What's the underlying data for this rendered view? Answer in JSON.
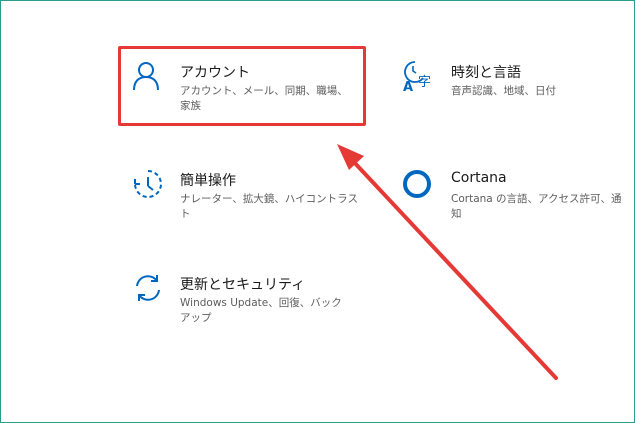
{
  "settings": {
    "tiles": [
      {
        "title": "アカウント",
        "desc": "アカウント、メール、同期、職場、家族",
        "icon": "person-icon"
      },
      {
        "title": "時刻と言語",
        "desc": "音声認識、地域、日付",
        "icon": "time-language-icon"
      },
      {
        "title": "簡単操作",
        "desc": "ナレーター、拡大鏡、ハイコントラスト",
        "icon": "ease-of-access-icon"
      },
      {
        "title": "Cortana",
        "desc": "Cortana の言語、アクセス許可、通知",
        "icon": "cortana-icon"
      },
      {
        "title": "更新とセキュリティ",
        "desc": "Windows Update、回復、バックアップ",
        "icon": "update-sync-icon"
      }
    ]
  },
  "colors": {
    "accent": "#0067c0",
    "annotation": "#e53935",
    "frame": "#2a9d8f"
  }
}
